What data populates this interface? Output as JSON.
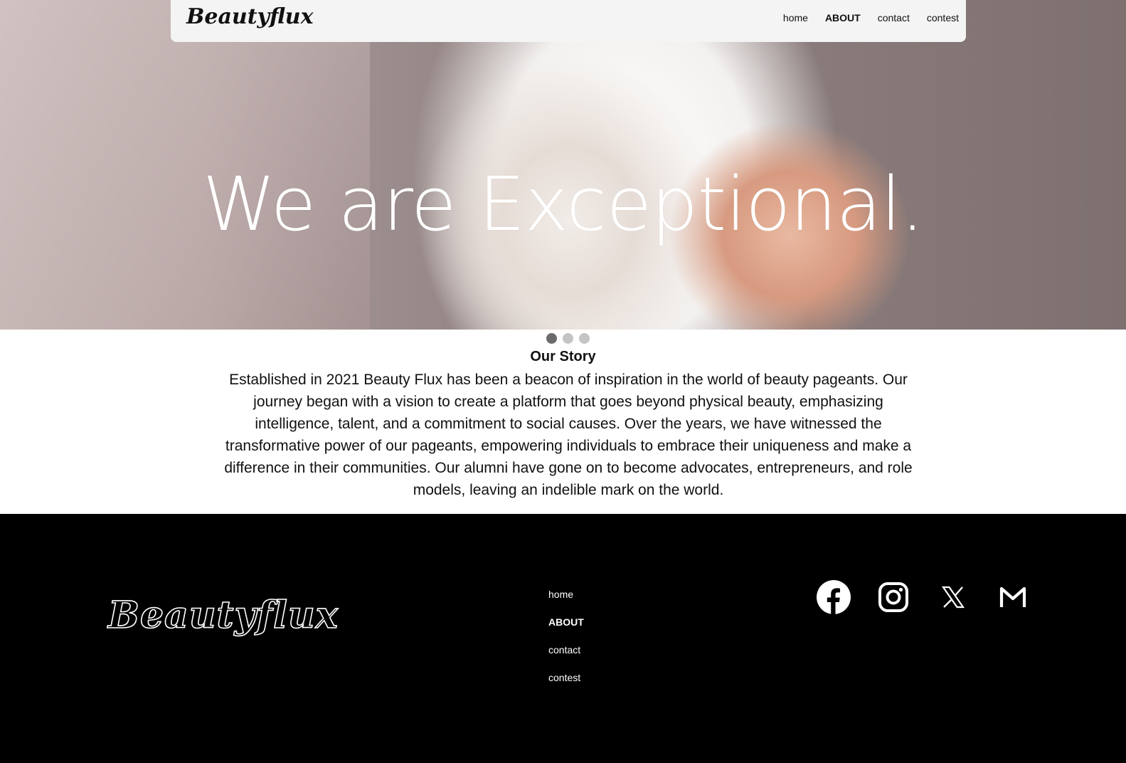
{
  "nav": {
    "logo": "Beautyflux",
    "links": [
      "home",
      "ABOUT",
      "contact",
      "contest"
    ]
  },
  "hero": {
    "title": "We are Exceptional."
  },
  "carousel": {
    "slides": 3,
    "active_index": 0
  },
  "story": {
    "title": "Our Story",
    "text": "Established in 2021 Beauty Flux has been a beacon of inspiration in the world of beauty pageants. Our journey began with a vision to create a platform that goes beyond physical beauty, emphasizing intelligence, talent, and a commitment to social causes. Over the years, we have witnessed the transformative power of our pageants, empowering individuals to embrace their uniqueness and make a difference in their communities. Our alumni have gone on to become advocates, entrepreneurs, and role models, leaving an indelible mark on the world."
  },
  "footer": {
    "logo": "Beautyflux",
    "links": [
      "home",
      "ABOUT",
      "contact",
      "contest"
    ],
    "social": [
      "facebook-icon",
      "instagram-icon",
      "x-icon",
      "gmail-icon"
    ]
  },
  "colors": {
    "footer_bg": "#000000",
    "nav_bg": "#f4f4f4",
    "dot_active": "#6b6b6b",
    "dot_inactive": "#c4c4c4"
  }
}
